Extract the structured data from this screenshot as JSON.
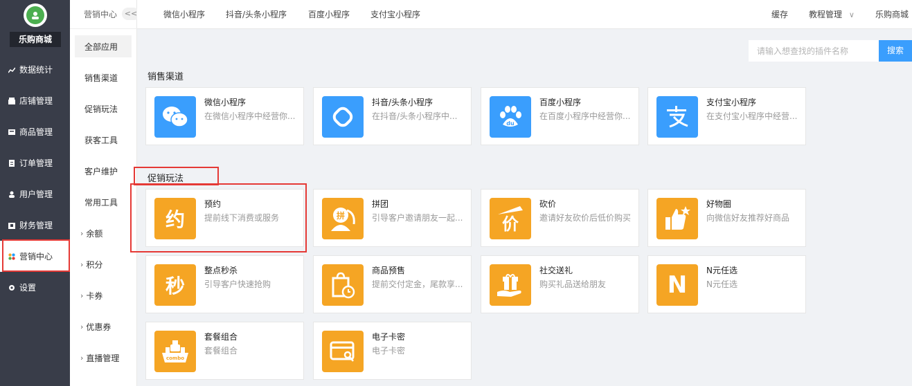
{
  "brand": {
    "name": "乐购商城"
  },
  "sidebar": {
    "items": [
      {
        "label": "数据统计",
        "icon": "chart-icon"
      },
      {
        "label": "店铺管理",
        "icon": "store-icon"
      },
      {
        "label": "商品管理",
        "icon": "product-icon"
      },
      {
        "label": "订单管理",
        "icon": "order-icon"
      },
      {
        "label": "用户管理",
        "icon": "user-icon"
      },
      {
        "label": "财务管理",
        "icon": "finance-icon"
      },
      {
        "label": "营销中心",
        "icon": "marketing-icon"
      },
      {
        "label": "设置",
        "icon": "gear-icon"
      }
    ]
  },
  "submenu": {
    "title": "营销中心",
    "collapse": "<<",
    "items": [
      {
        "label": "全部应用"
      },
      {
        "label": "销售渠道"
      },
      {
        "label": "促销玩法"
      },
      {
        "label": "获客工具"
      },
      {
        "label": "客户维护"
      },
      {
        "label": "常用工具"
      },
      {
        "label": "余额"
      },
      {
        "label": "积分"
      },
      {
        "label": "卡券"
      },
      {
        "label": "优惠券"
      },
      {
        "label": "直播管理"
      }
    ]
  },
  "topbar": {
    "tabs": [
      "微信小程序",
      "抖音/头条小程序",
      "百度小程序",
      "支付宝小程序"
    ],
    "right": {
      "cache": "缓存",
      "tutorial": "教程管理",
      "shop": "乐购商城"
    }
  },
  "search": {
    "placeholder": "请输入想查找的插件名称",
    "button": "搜索"
  },
  "sections": {
    "sales": {
      "title": "销售渠道",
      "cards": [
        {
          "name": "微信小程序",
          "desc": "在微信小程序中经营你...",
          "icon": "wechat-icon"
        },
        {
          "name": "抖音/头条小程序",
          "desc": "在抖音/头条小程序中...",
          "icon": "douyin-icon"
        },
        {
          "name": "百度小程序",
          "desc": "在百度小程序中经营你...",
          "icon": "baidu-icon"
        },
        {
          "name": "支付宝小程序",
          "desc": "在支付宝小程序中经营...",
          "icon": "alipay-icon"
        }
      ]
    },
    "promo": {
      "title": "促销玩法",
      "cards": [
        {
          "name": "预约",
          "desc": "提前线下消费或服务",
          "glyph": "约"
        },
        {
          "name": "拼团",
          "desc": "引导客户邀请朋友一起...",
          "glyph": "拼"
        },
        {
          "name": "砍价",
          "desc": "邀请好友砍价后低价购买",
          "glyph": "价"
        },
        {
          "name": "好物圈",
          "desc": "向微信好友推荐好商品",
          "glyph": "👍"
        },
        {
          "name": "整点秒杀",
          "desc": "引导客户快速抢购",
          "glyph": "秒"
        },
        {
          "name": "商品预售",
          "desc": "提前交付定金，尾款享...",
          "glyph": "⏱"
        },
        {
          "name": "社交送礼",
          "desc": "购买礼品送给朋友",
          "glyph": "🎁"
        },
        {
          "name": "N元任选",
          "desc": "N元任选",
          "glyph": "N"
        },
        {
          "name": "套餐组合",
          "desc": "套餐组合",
          "glyph": "combo"
        },
        {
          "name": "电子卡密",
          "desc": "电子卡密",
          "glyph": "▣"
        }
      ]
    }
  },
  "colors": {
    "sidebar": "#393d49",
    "accent": "#3a9efd",
    "orange": "#f5a524",
    "highlight": "#e53935"
  }
}
